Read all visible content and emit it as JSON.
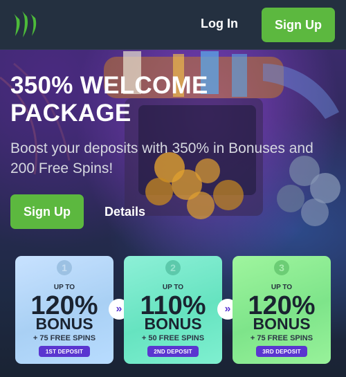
{
  "header": {
    "logo_icon": "claw-logo-icon",
    "login_label": "Log In",
    "signup_label": "Sign Up"
  },
  "hero": {
    "title": "350% WELCOME PACKAGE",
    "subtitle": "Boost your deposits with 350% in Bonuses and 200 Free Spins!",
    "signup_label": "Sign Up",
    "details_label": "Details"
  },
  "cards": [
    {
      "step": "1",
      "upto": "UP TO",
      "percent": "120%",
      "bonus": "BONUS",
      "spins": "+ 75 FREE SPINS",
      "deposit": "1ST DEPOSIT"
    },
    {
      "step": "2",
      "upto": "UP TO",
      "percent": "110%",
      "bonus": "BONUS",
      "spins": "+ 50 FREE SPINS",
      "deposit": "2ND DEPOSIT"
    },
    {
      "step": "3",
      "upto": "UP TO",
      "percent": "120%",
      "bonus": "BONUS",
      "spins": "+ 75 FREE SPINS",
      "deposit": "3RD DEPOSIT"
    }
  ],
  "arrows": [
    "»",
    "»"
  ],
  "colors": {
    "accent_green": "#5cb83f",
    "deposit_badge": "#5a35d0",
    "header_bg": "#243040"
  }
}
